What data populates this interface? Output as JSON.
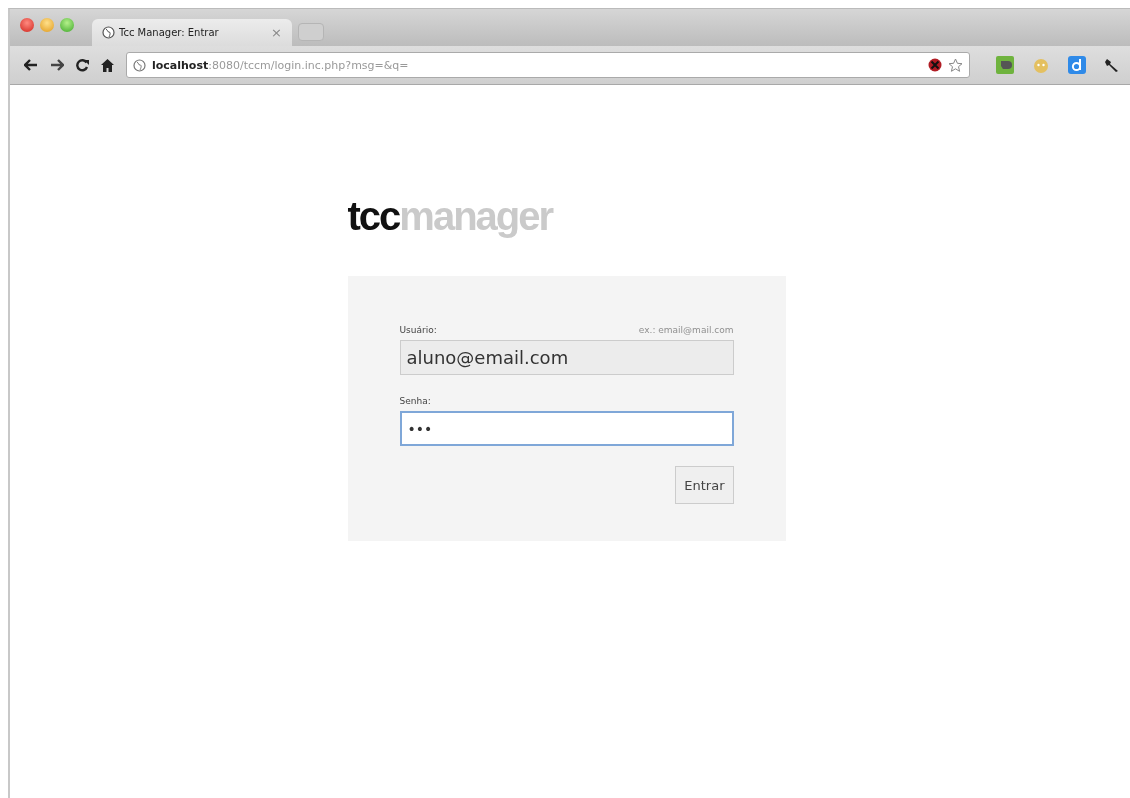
{
  "window": {
    "tabs": [
      {
        "title": "Tcc Manager: Entrar",
        "close": "×",
        "selected": true
      }
    ],
    "address": {
      "host": "localhost",
      "rest": ":8080/tccm/login.inc.php?msg=&q="
    }
  },
  "logo": {
    "parts": [
      "tcc",
      "manager"
    ]
  },
  "login": {
    "fields": [
      {
        "label": "Usuário:",
        "hint": "ex.: email@mail.com",
        "value": "aluno@email.com",
        "kind": "text",
        "focused": false
      },
      {
        "label": "Senha:",
        "value": "•••",
        "kind": "password",
        "focused": true
      }
    ],
    "button": "Entrar"
  }
}
